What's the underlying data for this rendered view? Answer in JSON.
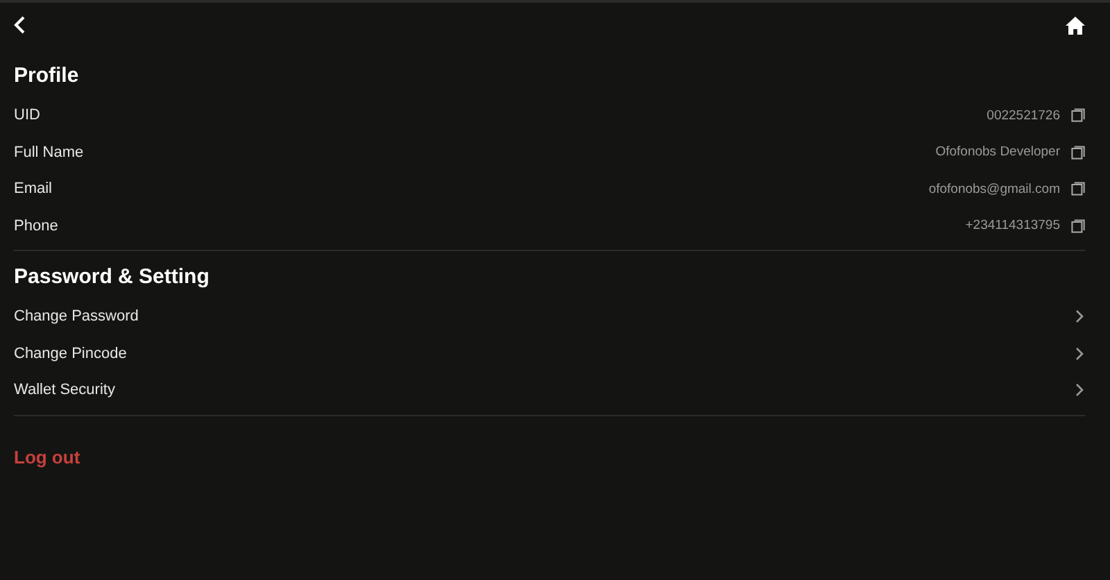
{
  "profile": {
    "title": "Profile",
    "fields": [
      {
        "label": "UID",
        "value": "0022521726"
      },
      {
        "label": "Full Name",
        "value": "Ofofonobs Developer"
      },
      {
        "label": "Email",
        "value": "ofofonobs@gmail.com"
      },
      {
        "label": "Phone",
        "value": "+234114313795"
      }
    ]
  },
  "settings": {
    "title": "Password & Setting",
    "items": [
      {
        "label": "Change Password"
      },
      {
        "label": "Change Pincode"
      },
      {
        "label": "Wallet Security"
      }
    ]
  },
  "logout": {
    "label": "Log out"
  }
}
